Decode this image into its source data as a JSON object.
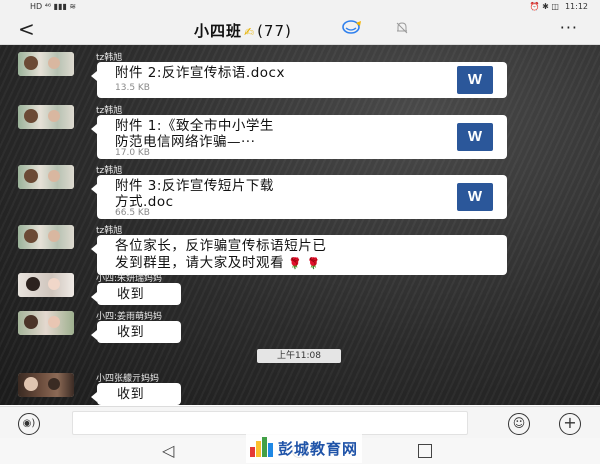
{
  "status_bar": {
    "left_text": "HD ⁴⁶ ▮▮▮ ≋",
    "right_icons": "⏰ ✱ ◫",
    "time": "11:12"
  },
  "header": {
    "back_label": "<",
    "title": "小四班",
    "title_emoji": "✍",
    "member_count": "(77)",
    "more_label": "···"
  },
  "messages": [
    {
      "sender": "tz韩旭",
      "file_title": "附件 2:反诈宣传标语.docx",
      "file_size": "13.5 KB",
      "file_icon": "W"
    },
    {
      "sender": "tz韩旭",
      "file_title": "附件 1:《致全市中小学生\n防范电信网络诈骗—···",
      "file_size": "17.0 KB",
      "file_icon": "W"
    },
    {
      "sender": "tz韩旭",
      "file_title": "附件 3:反诈宣传短片下载\n方式.doc",
      "file_size": "66.5 KB",
      "file_icon": "W"
    },
    {
      "sender": "tz韩旭",
      "text_line1": "各位家长，反诈骗宣传标语短片已",
      "text_line2": "发到群里，请大家及时观看",
      "emoji": "🌹 🌹"
    },
    {
      "sender": "小四:朱妍瑞妈妈",
      "text": "收到"
    },
    {
      "sender": "小四:姜雨萌妈妈",
      "text": "收到"
    },
    {
      "sender": "小四张艨亓妈妈",
      "text": "收到"
    }
  ],
  "time_divider": "上午11:08",
  "input_bar": {
    "voice_label": "◉)",
    "emoji_label": "☺",
    "plus_label": "+"
  },
  "nav_bar": {
    "back": "◁"
  },
  "watermark": {
    "text": "彭城教育网"
  },
  "colors": {
    "word_blue": "#2b579a",
    "chat_bg": "#2b2b2b",
    "watermark_blue": "#1f53a8"
  }
}
